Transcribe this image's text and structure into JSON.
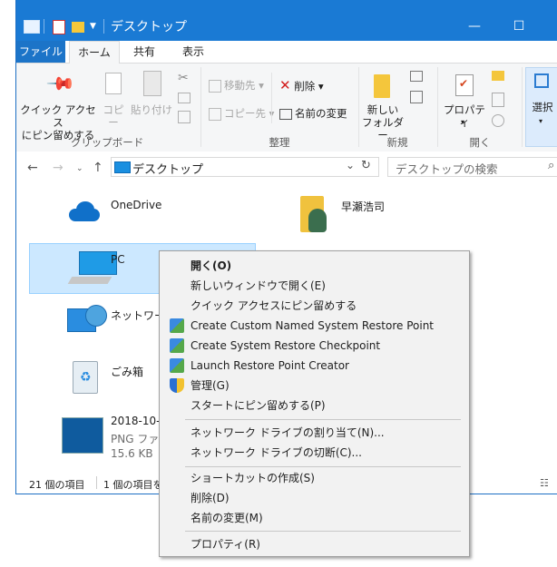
{
  "window": {
    "title": "デスクトップ",
    "controls": {
      "minimize": "—",
      "maximize": "☐",
      "close": "✕"
    }
  },
  "tabs": {
    "file": "ファイル",
    "home": "ホーム",
    "share": "共有",
    "view": "表示"
  },
  "ribbon": {
    "pin_quick_access": "クイック アクセス\nにピン留めする",
    "copy": "コピー",
    "paste": "貼り付け",
    "move_to": "移動先",
    "copy_to": "コピー先",
    "delete": "削除",
    "rename": "名前の変更",
    "new_folder": "新しい\nフォルダー",
    "properties": "プロパティ",
    "select": "選択",
    "groups": {
      "clipboard": "クリップボード",
      "organize": "整理",
      "new": "新規",
      "open": "開く"
    }
  },
  "address": {
    "path": "デスクトップ",
    "search_placeholder": "デスクトップの検索"
  },
  "items": {
    "onedrive": "OneDrive",
    "user_folder": "早瀬浩司",
    "pc": "PC",
    "network": "ネットワー",
    "recycle": "ごみ箱",
    "file_name": "2018-10-",
    "file_type": "PNG ファ",
    "file_size": "15.6 KB"
  },
  "status": {
    "count": "21 個の項目",
    "selected": "1 個の項目を"
  },
  "context_menu": {
    "open": "開く(O)",
    "open_new_window": "新しいウィンドウで開く(E)",
    "pin_quick_access": "クイック アクセスにピン留めする",
    "create_named_restore": "Create Custom Named System Restore Point",
    "create_restore": "Create System Restore Checkpoint",
    "launch_restore_creator": "Launch Restore Point Creator",
    "manage": "管理(G)",
    "pin_start": "スタートにピン留めする(P)",
    "map_drive": "ネットワーク ドライブの割り当て(N)...",
    "disconnect_drive": "ネットワーク ドライブの切断(C)...",
    "create_shortcut": "ショートカットの作成(S)",
    "delete": "削除(D)",
    "rename": "名前の変更(M)",
    "properties": "プロパティ(R)"
  },
  "colors": {
    "accent": "#1a7ad4",
    "selection": "#cce8ff",
    "menu_bg": "#f2f2f2"
  }
}
